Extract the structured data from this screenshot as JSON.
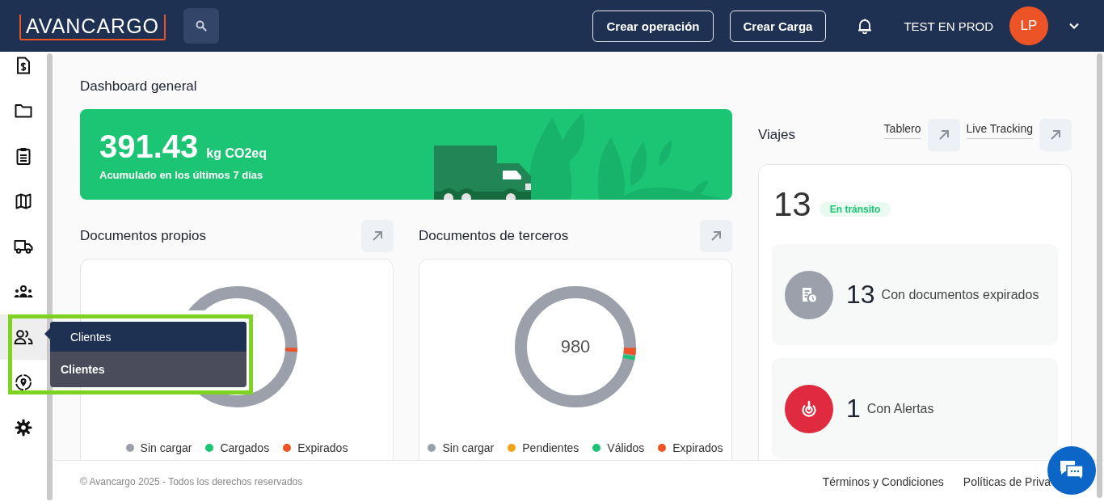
{
  "header": {
    "logo": "AVANCARGO",
    "buttons": [
      "Crear operación",
      "Crear Carga"
    ],
    "user_name": "TEST EN PROD",
    "avatar_initials": "LP"
  },
  "sidebar": {
    "items": [
      {
        "kind": "invoice",
        "selected": false
      },
      {
        "kind": "folder",
        "selected": false
      },
      {
        "kind": "clipboard",
        "selected": false
      },
      {
        "kind": "map",
        "selected": false
      },
      {
        "kind": "truck",
        "selected": false
      },
      {
        "kind": "team",
        "selected": false
      },
      {
        "kind": "users",
        "selected": true
      },
      {
        "kind": "location",
        "selected": false
      },
      {
        "kind": "settings",
        "selected": false
      }
    ]
  },
  "tooltip": {
    "title": "Clientes",
    "items": [
      "Clientes"
    ]
  },
  "page_title": "Dashboard general",
  "emissions": {
    "value": "391.43",
    "unit": "kg CO2eq",
    "caption": "Acumulado en los últimos 7 días"
  },
  "documents": [
    {
      "title": "Documentos propios",
      "legend": [
        {
          "label": "Sin cargar",
          "color": "#9ca0aa"
        },
        {
          "label": "Cargados",
          "color": "#1bc573"
        },
        {
          "label": "Expirados",
          "color": "#ec5428"
        }
      ]
    },
    {
      "title": "Documentos de terceros",
      "center_label": "980",
      "legend": [
        {
          "label": "Sin cargar",
          "color": "#9ca0aa"
        },
        {
          "label": "Pendientes",
          "color": "#f2a31b"
        },
        {
          "label": "Válidos",
          "color": "#1bc573"
        },
        {
          "label": "Expirados",
          "color": "#ec5428"
        }
      ]
    }
  ],
  "trips": {
    "title": "Viajes",
    "links": [
      "Tablero",
      "Live Tracking"
    ],
    "count": "13",
    "status": "En tránsito",
    "stats": [
      {
        "kind": "documents",
        "value": "13",
        "label": "Con documentos expirados"
      },
      {
        "kind": "alerts",
        "value": "1",
        "label": "Con Alertas"
      }
    ]
  },
  "footer": {
    "copyright": "© Avancargo 2025 - Todos los derechos reservados",
    "links": [
      "Términos y Condiciones",
      "Políticas de Priva"
    ]
  }
}
